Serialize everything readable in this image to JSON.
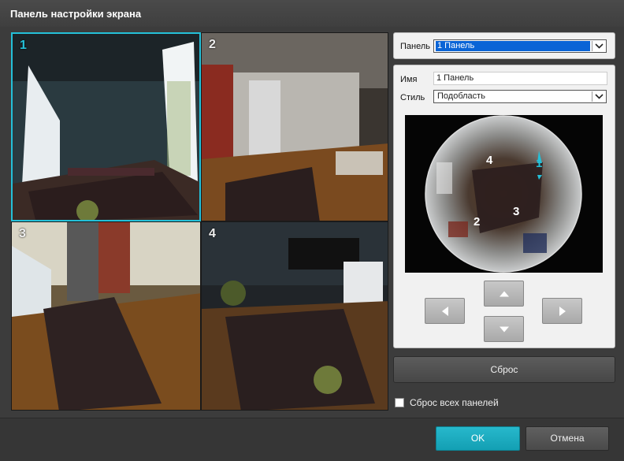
{
  "window": {
    "title": "Панель настройки экрана"
  },
  "views": [
    {
      "number": "1",
      "selected": true
    },
    {
      "number": "2",
      "selected": false
    },
    {
      "number": "3",
      "selected": false
    },
    {
      "number": "4",
      "selected": false
    }
  ],
  "panel": {
    "label": "Панель",
    "value": "1 Панель"
  },
  "settings": {
    "name_label": "Имя",
    "name_value": "1 Панель",
    "style_label": "Стиль",
    "style_value": "Подобласть"
  },
  "fisheye": {
    "region_labels": [
      "1",
      "2",
      "3",
      "4"
    ]
  },
  "ptz": {
    "icons": [
      "arrow-left-icon",
      "arrow-up-icon",
      "arrow-down-icon",
      "arrow-right-icon"
    ]
  },
  "reset_button": "Сброс",
  "reset_all": {
    "label": "Сброс всех панелей",
    "checked": false
  },
  "buttons": {
    "ok": "OK",
    "cancel": "Отмена"
  },
  "colors": {
    "accent": "#24c0d8",
    "selection": "#0a64d6"
  }
}
